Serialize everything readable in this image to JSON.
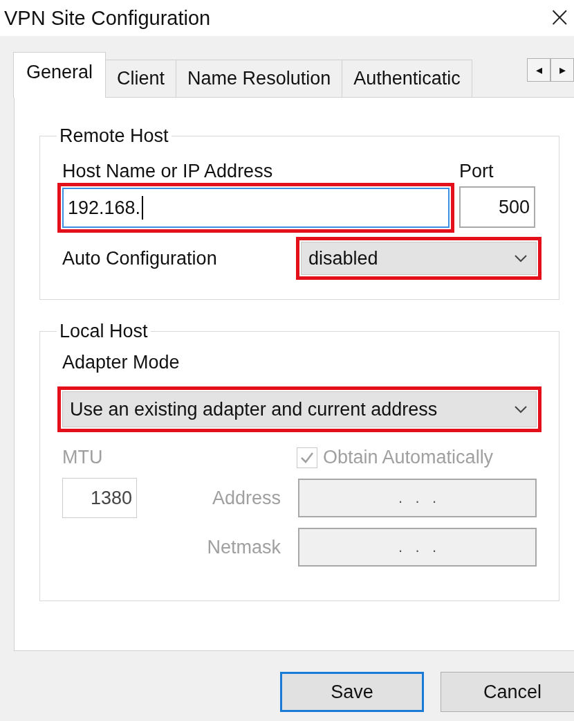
{
  "window": {
    "title": "VPN Site Configuration",
    "close": "×"
  },
  "tabs": [
    {
      "label": "General",
      "selected": true
    },
    {
      "label": "Client",
      "selected": false
    },
    {
      "label": "Name Resolution",
      "selected": false
    },
    {
      "label": "Authenticatic",
      "selected": false
    }
  ],
  "tab_scroll": [
    "◂",
    "▸"
  ],
  "remote_host": {
    "title": "Remote Host",
    "host_label": "Host Name or IP Address",
    "host": {
      "value": "192.168.",
      "focused": true,
      "highlighted": true
    },
    "port_label": "Port",
    "port": {
      "value": "500"
    },
    "auto_label": "Auto Configuration",
    "auto": {
      "value": "disabled",
      "highlighted": true
    }
  },
  "local_host": {
    "title": "Local Host",
    "adapter_label": "Adapter Mode",
    "adapter": {
      "value": "Use an existing adapter and current address",
      "highlighted": true
    },
    "mtu_label": "MTU",
    "mtu": {
      "value": "1380",
      "disabled": true
    },
    "obtain": {
      "label": "Obtain Automatically",
      "checked": true,
      "disabled": true
    },
    "address_label": "Address",
    "address": {
      "value": ".   .   .",
      "disabled": true
    },
    "netmask_label": "Netmask",
    "netmask": {
      "value": ".   .   .",
      "disabled": true
    }
  },
  "buttons": [
    {
      "label": "Save",
      "default": true
    },
    {
      "label": "Cancel",
      "default": false
    }
  ]
}
